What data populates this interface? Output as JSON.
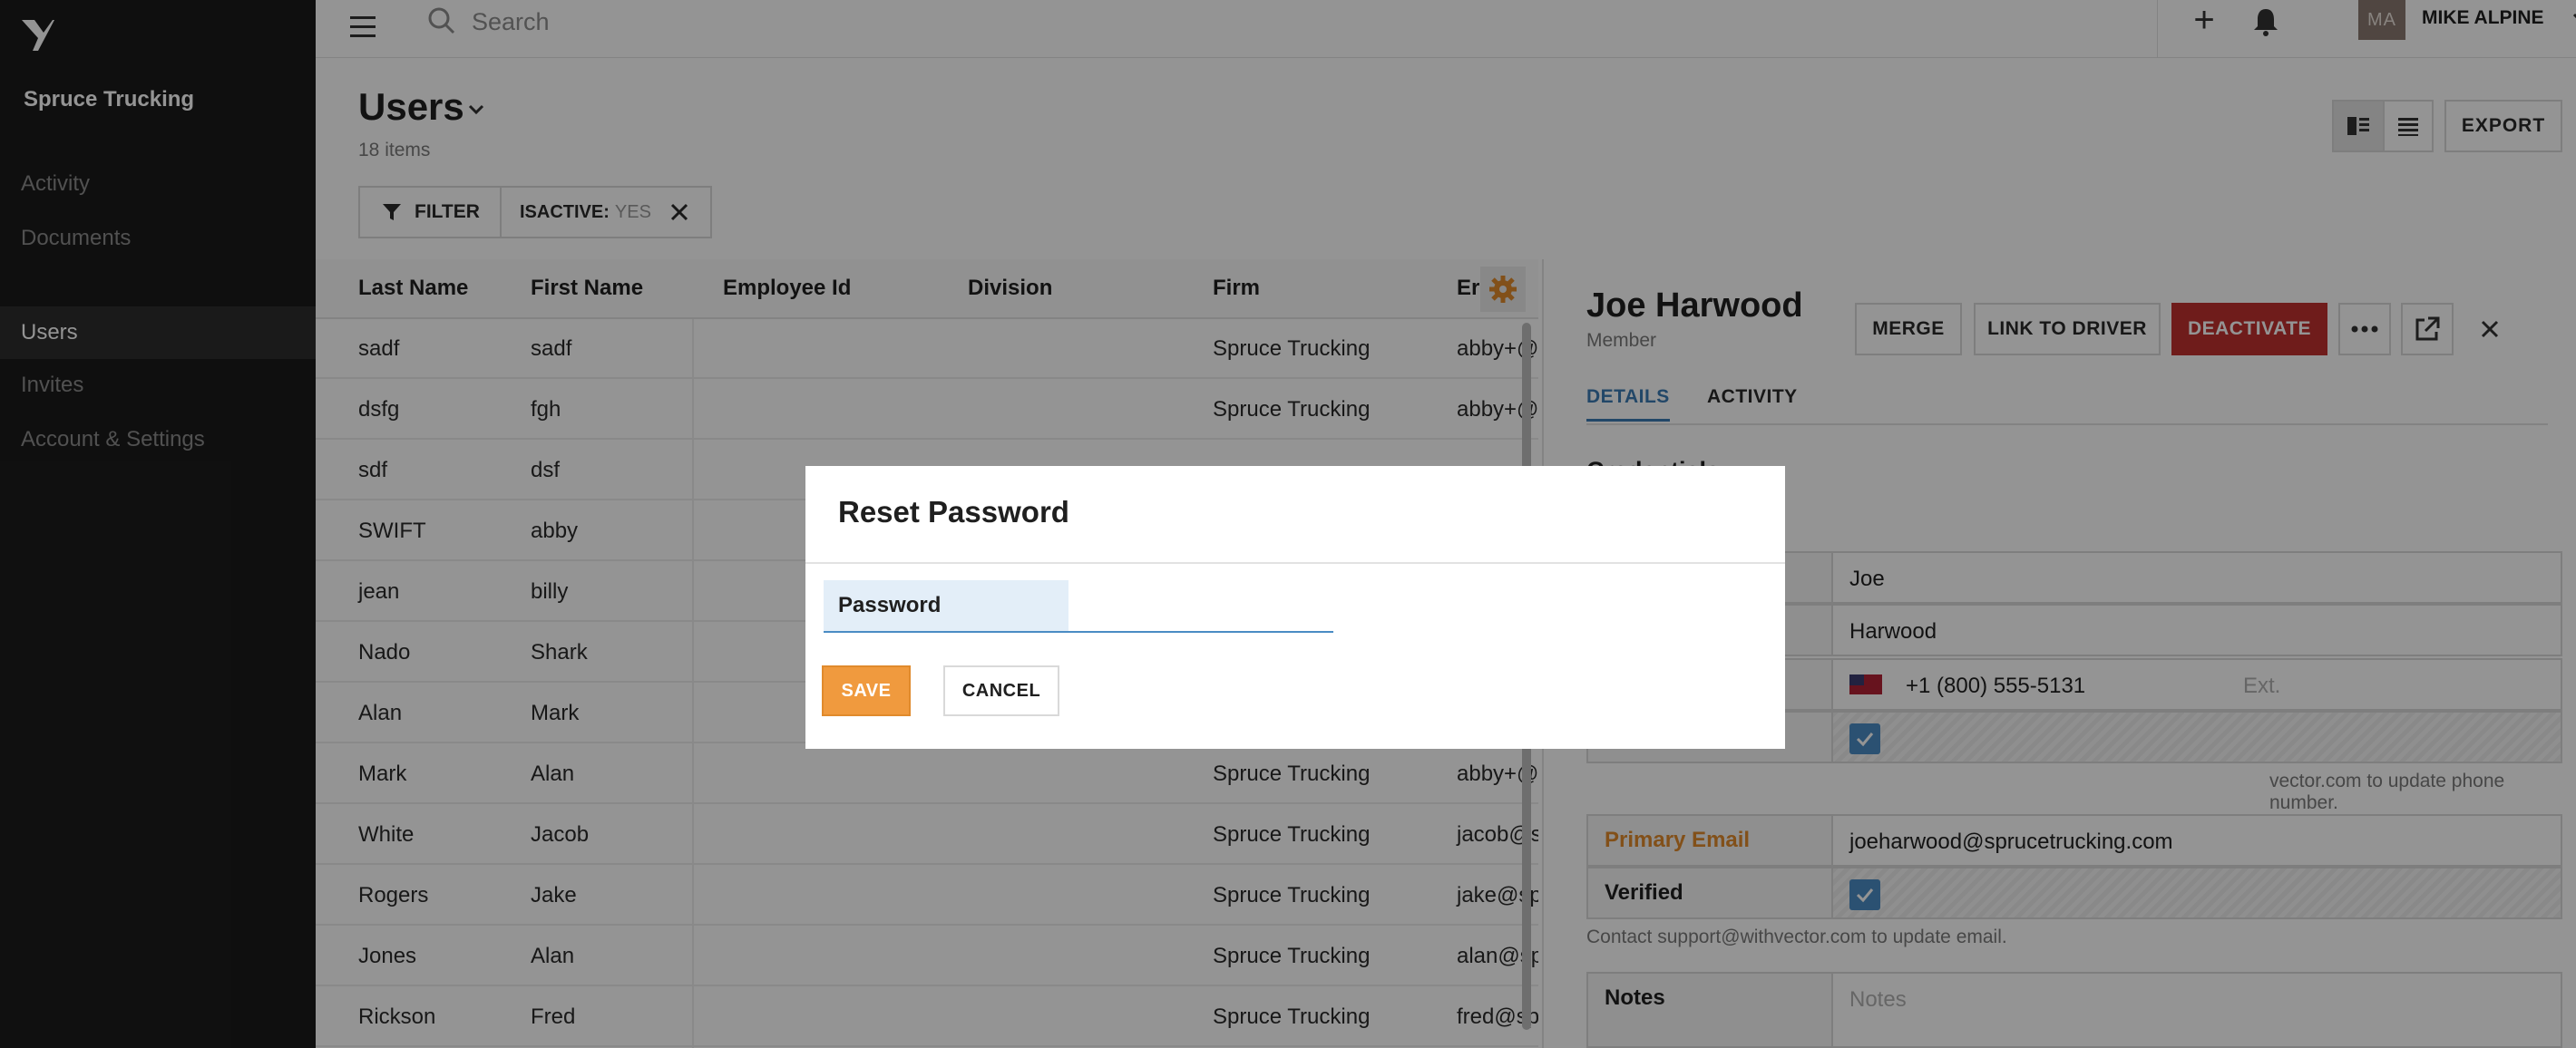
{
  "app": {
    "org_name": "Spruce Trucking"
  },
  "sidebar": {
    "items": [
      {
        "label": "Activity",
        "active": false
      },
      {
        "label": "Documents",
        "active": false
      },
      {
        "label": "Users",
        "active": true
      },
      {
        "label": "Invites",
        "active": false
      },
      {
        "label": "Account & Settings",
        "active": false
      }
    ]
  },
  "topbar": {
    "search_placeholder": "Search",
    "avatar_initials": "MA",
    "user_name": "MIKE ALPINE",
    "icons": [
      "menu-icon",
      "search-icon",
      "plus-icon",
      "bell-icon",
      "chevron-down-icon"
    ]
  },
  "page": {
    "title": "Users",
    "item_count": "18 items",
    "filter_label": "FILTER",
    "filter_chip_key": "ISACTIVE:",
    "filter_chip_value": "YES",
    "export_label": "EXPORT"
  },
  "table": {
    "columns": [
      "Last Name",
      "First Name",
      "Employee Id",
      "Division",
      "Firm",
      "Er"
    ],
    "rows": [
      {
        "last": "sadf",
        "first": "sadf",
        "firm": "Spruce Trucking",
        "email": "abby+@"
      },
      {
        "last": "dsfg",
        "first": "fgh",
        "firm": "Spruce Trucking",
        "email": "abby+@"
      },
      {
        "last": "sdf",
        "first": "dsf",
        "firm": "",
        "email": ""
      },
      {
        "last": "SWIFT",
        "first": "abby",
        "firm": "",
        "email": ""
      },
      {
        "last": "jean",
        "first": "billy",
        "firm": "",
        "email": ""
      },
      {
        "last": "Nado",
        "first": "Shark",
        "firm": "",
        "email": ""
      },
      {
        "last": "Alan",
        "first": "Mark",
        "firm": "",
        "email": ""
      },
      {
        "last": "Mark",
        "first": "Alan",
        "firm": "Spruce Trucking",
        "email": "abby+@"
      },
      {
        "last": "White",
        "first": "Jacob",
        "firm": "Spruce Trucking",
        "email": "jacob@s"
      },
      {
        "last": "Rogers",
        "first": "Jake",
        "firm": "Spruce Trucking",
        "email": "jake@sp"
      },
      {
        "last": "Jones",
        "first": "Alan",
        "firm": "Spruce Trucking",
        "email": "alan@sp"
      },
      {
        "last": "Rickson",
        "first": "Fred",
        "firm": "Spruce Trucking",
        "email": "fred@sp"
      }
    ]
  },
  "detail": {
    "name": "Joe Harwood",
    "role": "Member",
    "buttons": {
      "merge": "MERGE",
      "link_driver": "LINK TO DRIVER",
      "deactivate": "DEACTIVATE"
    },
    "tabs": [
      {
        "label": "DETAILS",
        "active": true
      },
      {
        "label": "ACTIVITY",
        "active": false
      }
    ],
    "section_title": "Credentials",
    "first_name": "Joe",
    "last_name": "Harwood",
    "phone": "+1 (800) 555-5131",
    "ext_placeholder": "Ext.",
    "phone_hint": "vector.com to update phone number.",
    "email_label": "Primary Email",
    "email": "joeharwood@sprucetrucking.com",
    "verified_label": "Verified",
    "email_hint": "Contact support@withvector.com to update email.",
    "notes_label": "Notes",
    "notes_placeholder": "Notes"
  },
  "modal": {
    "title": "Reset Password",
    "password_label": "Password",
    "password_value": "",
    "save_label": "SAVE",
    "cancel_label": "CANCEL"
  },
  "colors": {
    "sidebar_bg": "#1b1b1b",
    "accent_blue": "#3b7bb3",
    "save_orange": "#f09a3e",
    "danger_red": "#c0312f"
  }
}
